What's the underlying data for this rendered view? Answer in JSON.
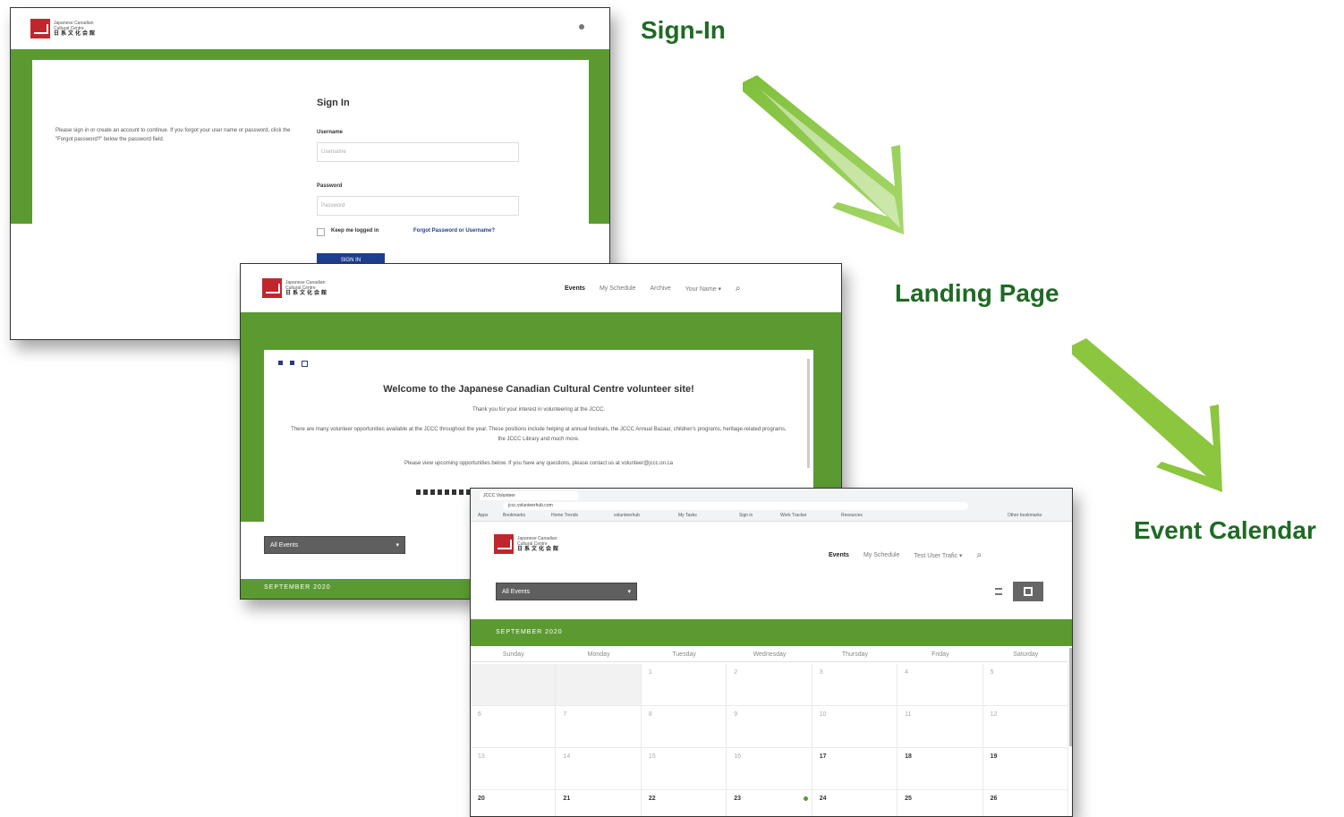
{
  "flow": {
    "signin_label": "Sign-In",
    "landing_label": "Landing Page",
    "calendar_label": "Event Calendar"
  },
  "colors": {
    "brand_green": "#5b9a31",
    "label_green": "#1f6a24",
    "arrow_green": "#8cc63f",
    "logo_red": "#c0272d",
    "button_blue": "#1f3f8f"
  },
  "logo": {
    "line1": "Japanese Canadian",
    "line2": "Cultural Centre",
    "kanji": "日系文化会館"
  },
  "signin": {
    "intro": "Please sign in or create an account to continue. If you forgot your user name or password, click the \"Forgot password?\" below the password field.",
    "title": "Sign In",
    "username_label": "Username",
    "username_placeholder": "Username",
    "password_label": "Password",
    "password_placeholder": "Password",
    "keep_logged_in": "Keep me logged in",
    "forgot_link": "Forgot Password or Username?",
    "signin_button": "SIGN IN"
  },
  "landing": {
    "nav": [
      "Events",
      "My Schedule",
      "Archive",
      "Your Name"
    ],
    "welcome_title": "Welcome to the Japanese Canadian Cultural Centre volunteer site!",
    "thanks": "Thank you for your interest in volunteering at the JCCC.",
    "body": "There are many volunteer opportunities available at the JCCC throughout the year. These positions include helping at annual festivals, the JCCC Annual Bazaar, children's programs, heritage-related programs, the JCCC Library and much more.",
    "contact": "Please view upcoming opportunities below. If you have any questions, please contact us at volunteer@jccc.on.ca",
    "filter_value": "All Events",
    "month": "SEPTEMBER 2020"
  },
  "calendar": {
    "nav": [
      "Events",
      "My Schedule",
      "Test User Trafic"
    ],
    "filter_value": "All Events",
    "month": "SEPTEMBER 2020",
    "weekdays": [
      "Sunday",
      "Monday",
      "Tuesday",
      "Wednesday",
      "Thursday",
      "Friday",
      "Saturday"
    ],
    "days": [
      "",
      "",
      "1",
      "2",
      "3",
      "4",
      "5",
      "6",
      "7",
      "8",
      "9",
      "10",
      "11",
      "12",
      "13",
      "14",
      "15",
      "16",
      "17",
      "18",
      "19",
      "20",
      "21",
      "22",
      "23",
      "24",
      "25",
      "26"
    ],
    "url": "jccc.volunteerhub.com",
    "bookmarks": [
      "Apps",
      "Bookmarks",
      "Home Trends",
      "volunteerhub",
      "My Tasks",
      "Sign in",
      "Work Tracker",
      "Resources",
      "Other bookmarks"
    ]
  }
}
